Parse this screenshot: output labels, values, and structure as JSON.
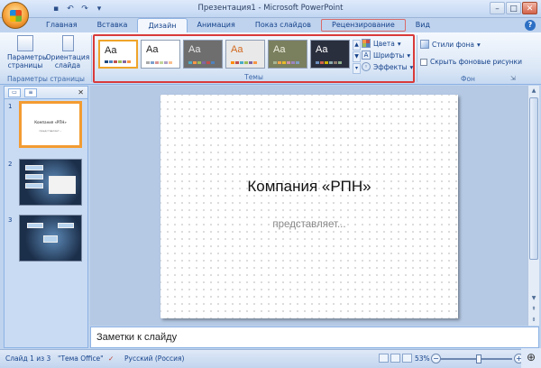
{
  "window": {
    "title": "Презентация1 - Microsoft PowerPoint",
    "controls": [
      "–",
      "□",
      "✕"
    ]
  },
  "qat": {
    "icons": [
      "save-icon",
      "undo-icon",
      "redo-icon",
      "customize-icon"
    ]
  },
  "tabs": [
    {
      "label": "Главная"
    },
    {
      "label": "Вставка"
    },
    {
      "label": "Дизайн"
    },
    {
      "label": "Анимация"
    },
    {
      "label": "Показ слайдов"
    },
    {
      "label": "Рецензирование"
    },
    {
      "label": "Вид"
    }
  ],
  "active_tab": "Дизайн",
  "ribbon": {
    "page_setup": {
      "params_label": "Параметры страницы",
      "orientation_label": "Ориентация слайда",
      "group_label": "Параметры страницы"
    },
    "themes": {
      "group_label": "Темы",
      "thumb_text": "Aa",
      "colors_label": "Цвета",
      "fonts_label": "Шрифты",
      "effects_label": "Эффекты",
      "items": [
        {
          "bg": "#ffffff",
          "fg": "#222222",
          "swatches": [
            "#1f497d",
            "#4f81bd",
            "#c0504d",
            "#9bbb59",
            "#8064a2",
            "#f79646"
          ]
        },
        {
          "bg": "#ffffff",
          "fg": "#222222",
          "swatches": [
            "#a9a9a9",
            "#7ba0cd",
            "#d99694",
            "#c3d69b",
            "#b2a1c7",
            "#fac08f"
          ]
        },
        {
          "bg": "#6e6e6e",
          "fg": "#e8e8e8",
          "swatches": [
            "#4bacc6",
            "#f79646",
            "#9bbb59",
            "#8064a2",
            "#c0504d",
            "#4f81bd"
          ]
        },
        {
          "bg": "#e9e9e9",
          "fg": "#d2691e",
          "swatches": [
            "#ff8c00",
            "#c0504d",
            "#4bacc6",
            "#9bbb59",
            "#8064a2",
            "#f79646"
          ]
        },
        {
          "bg": "#7a7f5e",
          "fg": "#f0f0e0",
          "swatches": [
            "#a5b592",
            "#f3a447",
            "#e7bc29",
            "#d092a7",
            "#9c85c0",
            "#809ec2"
          ]
        },
        {
          "bg": "#2a2f3e",
          "fg": "#ffffff",
          "swatches": [
            "#6c8ebf",
            "#d16349",
            "#ccb400",
            "#8cadae",
            "#8c7b70",
            "#8fb08c"
          ]
        }
      ]
    },
    "background": {
      "styles_label": "Стили фона",
      "hide_label": "Скрыть фоновые рисунки",
      "group_label": "Фон"
    }
  },
  "slides_panel": {
    "slides": [
      {
        "num": "1",
        "title": "Компания «РПН»",
        "subtitle": "представляет..."
      },
      {
        "num": "2"
      },
      {
        "num": "3"
      }
    ]
  },
  "slide": {
    "title": "Компания «РПН»",
    "subtitle": "представляет..."
  },
  "notes": {
    "placeholder": "Заметки к слайду"
  },
  "status": {
    "slide_info": "Слайд 1 из 3",
    "theme": "\"Тема Office\"",
    "language": "Русский (Россия)",
    "zoom": "53%",
    "zoom_fraction": 0.53
  }
}
